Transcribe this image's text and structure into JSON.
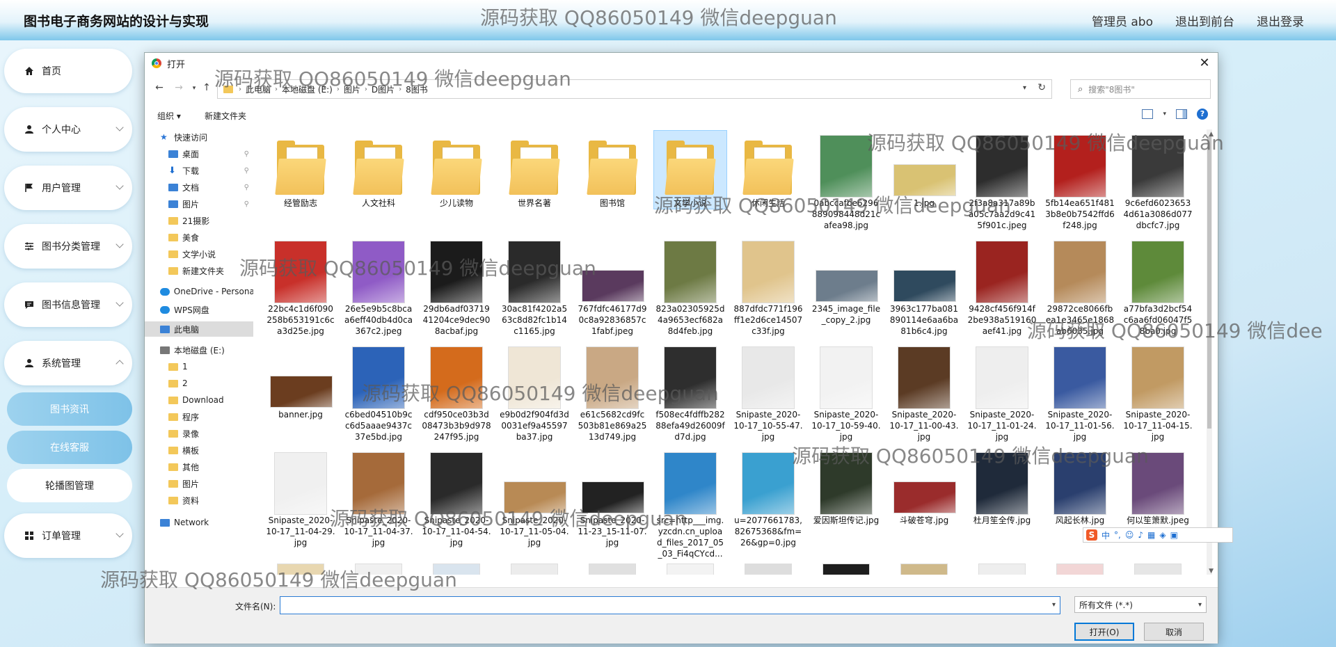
{
  "header": {
    "site_title": "图书电子商务网站的设计与实现",
    "admin_label": "管理员 abo",
    "front_link": "退出到前台",
    "logout_link": "退出登录"
  },
  "watermark_text": "源码获取 QQ86050149 微信deepguan",
  "watermark_text_alt": "源码获取 QQ86050149 微信deepguân",
  "watermark_text_cut": "源码获取 QQ86050149 微信dee",
  "sidebar": {
    "items": [
      {
        "label": "首页",
        "icon": "home-icon"
      },
      {
        "label": "个人中心",
        "icon": "person-icon"
      },
      {
        "label": "用户管理",
        "icon": "flag-icon"
      },
      {
        "label": "图书分类管理",
        "icon": "sliders-icon"
      },
      {
        "label": "图书信息管理",
        "icon": "chat-icon"
      },
      {
        "label": "系统管理",
        "icon": "person-icon"
      }
    ],
    "sub_items": [
      "图书资讯",
      "在线客服",
      "轮播图管理"
    ],
    "order_item": {
      "label": "订单管理",
      "icon": "grid-icon"
    }
  },
  "dialog": {
    "title": "打开",
    "breadcrumbs": [
      "此电脑",
      "本地磁盘 (E:)",
      "图片",
      "D图片",
      "8图书"
    ],
    "search_placeholder": "搜索\"8图书\"",
    "organize": "组织 ▾",
    "new_folder": "新建文件夹",
    "nav_pane": [
      {
        "label": "快速访问",
        "icon": "star-icon"
      },
      {
        "label": "桌面",
        "icon": "desktop-icon"
      },
      {
        "label": "下载",
        "icon": "download-icon"
      },
      {
        "label": "文档",
        "icon": "document-icon"
      },
      {
        "label": "图片",
        "icon": "pictures-icon"
      },
      {
        "label": "21摄影",
        "icon": "folder-icon"
      },
      {
        "label": "美食",
        "icon": "folder-icon"
      },
      {
        "label": "文学小说",
        "icon": "folder-icon"
      },
      {
        "label": "新建文件夹",
        "icon": "folder-icon"
      },
      {
        "label": "OneDrive - Persona",
        "icon": "cloud-icon"
      },
      {
        "label": "WPS网盘",
        "icon": "cloud-icon"
      },
      {
        "label": "此电脑",
        "icon": "pc-icon"
      },
      {
        "label": "本地磁盘 (E:)",
        "icon": "drive-icon"
      },
      {
        "label": "1",
        "icon": "folder-icon"
      },
      {
        "label": "2",
        "icon": "folder-icon"
      },
      {
        "label": "Download",
        "icon": "folder-icon"
      },
      {
        "label": "程序",
        "icon": "folder-icon"
      },
      {
        "label": "录像",
        "icon": "folder-icon"
      },
      {
        "label": "横板",
        "icon": "folder-icon"
      },
      {
        "label": "其他",
        "icon": "folder-icon"
      },
      {
        "label": "图片",
        "icon": "folder-icon"
      },
      {
        "label": "资料",
        "icon": "folder-icon"
      },
      {
        "label": "Network",
        "icon": "network-icon"
      }
    ],
    "files_row1": [
      {
        "name": "经管励志",
        "kind": "folder"
      },
      {
        "name": "人文社科",
        "kind": "folder"
      },
      {
        "name": "少儿读物",
        "kind": "folder"
      },
      {
        "name": "世界名著",
        "kind": "folder"
      },
      {
        "name": "图书馆",
        "kind": "folder"
      },
      {
        "name": "文学小说",
        "kind": "folder"
      },
      {
        "name": "休闲生活",
        "kind": "folder"
      },
      {
        "name": "0abccafbe6296889098448d21cafea98.jpg",
        "kind": "image",
        "color": "#4f8f5a"
      },
      {
        "name": "1.jpg",
        "kind": "image",
        "color": "#d9c273"
      },
      {
        "name": "2f3a8a317a89ba05c7aa2d9c415f901c.jpeg",
        "kind": "image",
        "color": "#2d2d2d"
      },
      {
        "name": "5fb14ea651f4813b8e0b7542ffd6f248.jpg",
        "kind": "image",
        "color": "#b3201d"
      },
      {
        "name": "9c6efd60236534d61a3086d077dbcfc7.jpg",
        "kind": "image",
        "color": "#3a3a3a"
      }
    ],
    "files_row2": [
      {
        "name": "22bc4c1d6f090258b653191c6ca3d25e.jpg",
        "color": "#c8302a"
      },
      {
        "name": "26e5e9b5c8bcaa6eff40db4d0ca367c2.jpeg",
        "color": "#8f5bc6"
      },
      {
        "name": "29db6adf0371941204ce9dec908acbaf.jpg",
        "color": "#1b1b1b"
      },
      {
        "name": "30ac81f4202a563c8d82fc1b14c1165.jpg",
        "color": "#2a2a2a"
      },
      {
        "name": "767fdfc46177d90c8a92836857c1fabf.jpeg",
        "color": "#5a3a5e"
      },
      {
        "name": "823a02305925d4a9653ecf682a8d4feb.jpg",
        "color": "#6d7a44"
      },
      {
        "name": "887dfdc771f196ff1e2d6ce14507c33f.jpg",
        "color": "#e0c48c"
      },
      {
        "name": "2345_image_file_copy_2.jpg",
        "color": "#6d7d8c"
      },
      {
        "name": "3963c177ba081890114e6aa6ba81b6c4.jpg",
        "color": "#2f4a5e"
      },
      {
        "name": "9428cf456f914f2be938a519160aef41.jpg",
        "color": "#9a2420"
      },
      {
        "name": "29872ce8066fbea1e3465e1868ab6035.jpg",
        "color": "#b58a5a"
      },
      {
        "name": "a77bfa3d2bcf54c6aa6fd06047f58ba0.jpg",
        "color": "#5e8a3a"
      }
    ],
    "files_row3": [
      {
        "name": "banner.jpg",
        "color": "#6b3d1f"
      },
      {
        "name": "c6bed04510b9cc6d5aaae9437c37e5bd.jpg",
        "color": "#2c63b8"
      },
      {
        "name": "cdf950ce03b3d08473b3b9d978247f95.jpg",
        "color": "#d46b1c"
      },
      {
        "name": "e9b0d2f904fd3d0031ef9a45597ba37.jpg",
        "color": "#efe6d6"
      },
      {
        "name": "e61c5682cd9fc503b81e869a2513d749.jpg",
        "color": "#c9a884"
      },
      {
        "name": "f508ec4fdffb28288efa49d26009fd7d.jpg",
        "color": "#2e2e2e"
      },
      {
        "name": "Snipaste_2020-10-17_10-55-47.jpg",
        "color": "#e8e8e8"
      },
      {
        "name": "Snipaste_2020-10-17_10-59-40.jpg",
        "color": "#f2f2f2"
      },
      {
        "name": "Snipaste_2020-10-17_11-00-43.jpg",
        "color": "#5b3b24"
      },
      {
        "name": "Snipaste_2020-10-17_11-01-24.jpg",
        "color": "#eeeeee"
      },
      {
        "name": "Snipaste_2020-10-17_11-01-56.jpg",
        "color": "#3a5aa0"
      },
      {
        "name": "Snipaste_2020-10-17_11-04-15.jpg",
        "color": "#c19a63"
      }
    ],
    "files_row4": [
      {
        "name": "Snipaste_2020-10-17_11-04-29.jpg",
        "color": "#f0f0f0"
      },
      {
        "name": "Snipaste_2020-10-17_11-04-37.jpg",
        "color": "#a56a3a"
      },
      {
        "name": "Snipaste_2020-10-17_11-04-54.jpg",
        "color": "#2a2a2a"
      },
      {
        "name": "Snipaste_2020-10-17_11-05-04.jpg",
        "color": "#b88a55"
      },
      {
        "name": "Snipaste_2020-11-23_15-11-07.jpg",
        "color": "#222222"
      },
      {
        "name": "src=http___img.yzcdn.cn_upload_files_2017_05_03_Fi4qCYcd...",
        "color": "#2f86c9"
      },
      {
        "name": "u=2077661783,82675368&fm=26&gp=0.jpg",
        "color": "#3aa0d0"
      },
      {
        "name": "爱因斯坦传记.jpg",
        "color": "#2e3a2a"
      },
      {
        "name": "斗破苍穹.jpg",
        "color": "#9a2c2c"
      },
      {
        "name": "杜月笙全传.jpg",
        "color": "#1f2a3a"
      },
      {
        "name": "风起长林.jpg",
        "color": "#2a3f6e"
      },
      {
        "name": "何以笙箫默.jpeg",
        "color": "#6a4a7a"
      }
    ],
    "file_name_label": "文件名(N):",
    "file_name_value": "",
    "file_type": "所有文件 (*.*)",
    "open_button": "打开(O)",
    "cancel_button": "取消"
  },
  "ime_toolbar": {
    "logo": "S",
    "lang": "中"
  }
}
